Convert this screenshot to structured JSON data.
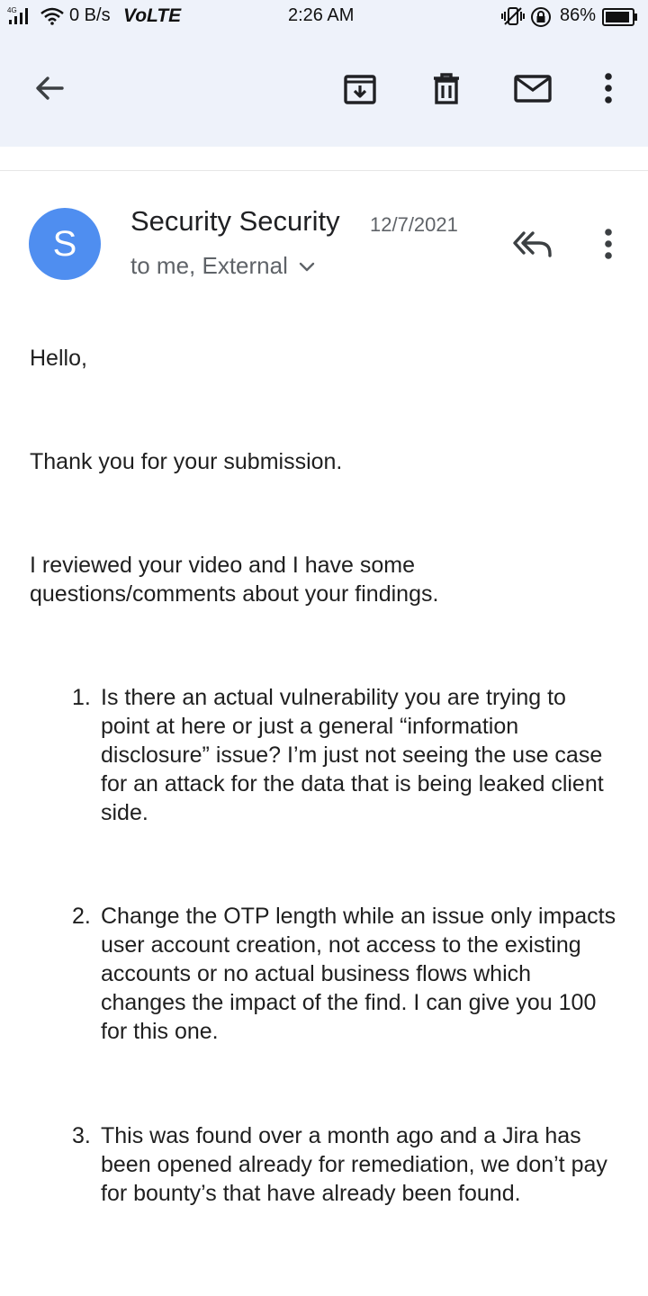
{
  "status_bar": {
    "network": "4G",
    "speed": "0 B/s",
    "volte": "VoLTE",
    "time": "2:26 AM",
    "battery": "86%"
  },
  "toolbar": {
    "back_icon": "arrow-left-icon",
    "archive_icon": "archive-icon",
    "delete_icon": "trash-icon",
    "mark_unread_icon": "mail-icon",
    "more_icon": "more-vert-icon"
  },
  "message": {
    "avatar_letter": "S",
    "avatar_color": "#4f8ef0",
    "sender": "Security Security",
    "date": "12/7/2021",
    "recipients": "to me, External",
    "body": {
      "greeting": "Hello,",
      "thanks": "Thank you for your submission.",
      "intro": "I reviewed your video and I have some questions/comments about your findings.",
      "points": [
        {
          "num": "1.",
          "text": "Is there an actual vulnerability you are trying to point at here or just a general “information disclosure” issue? I’m just not seeing the use case for an attack for the data that is being leaked client side."
        },
        {
          "num": "2.",
          "text": "Change the OTP length while an issue only impacts user account creation, not access to the existing accounts or no actual business flows which changes the impact of the find. I can give you 100 for this one."
        },
        {
          "num": "3.",
          "text": "This was found over a month ago and a Jira has been opened already for remediation, we don’t pay for bounty’s that have already been found."
        }
      ]
    }
  }
}
